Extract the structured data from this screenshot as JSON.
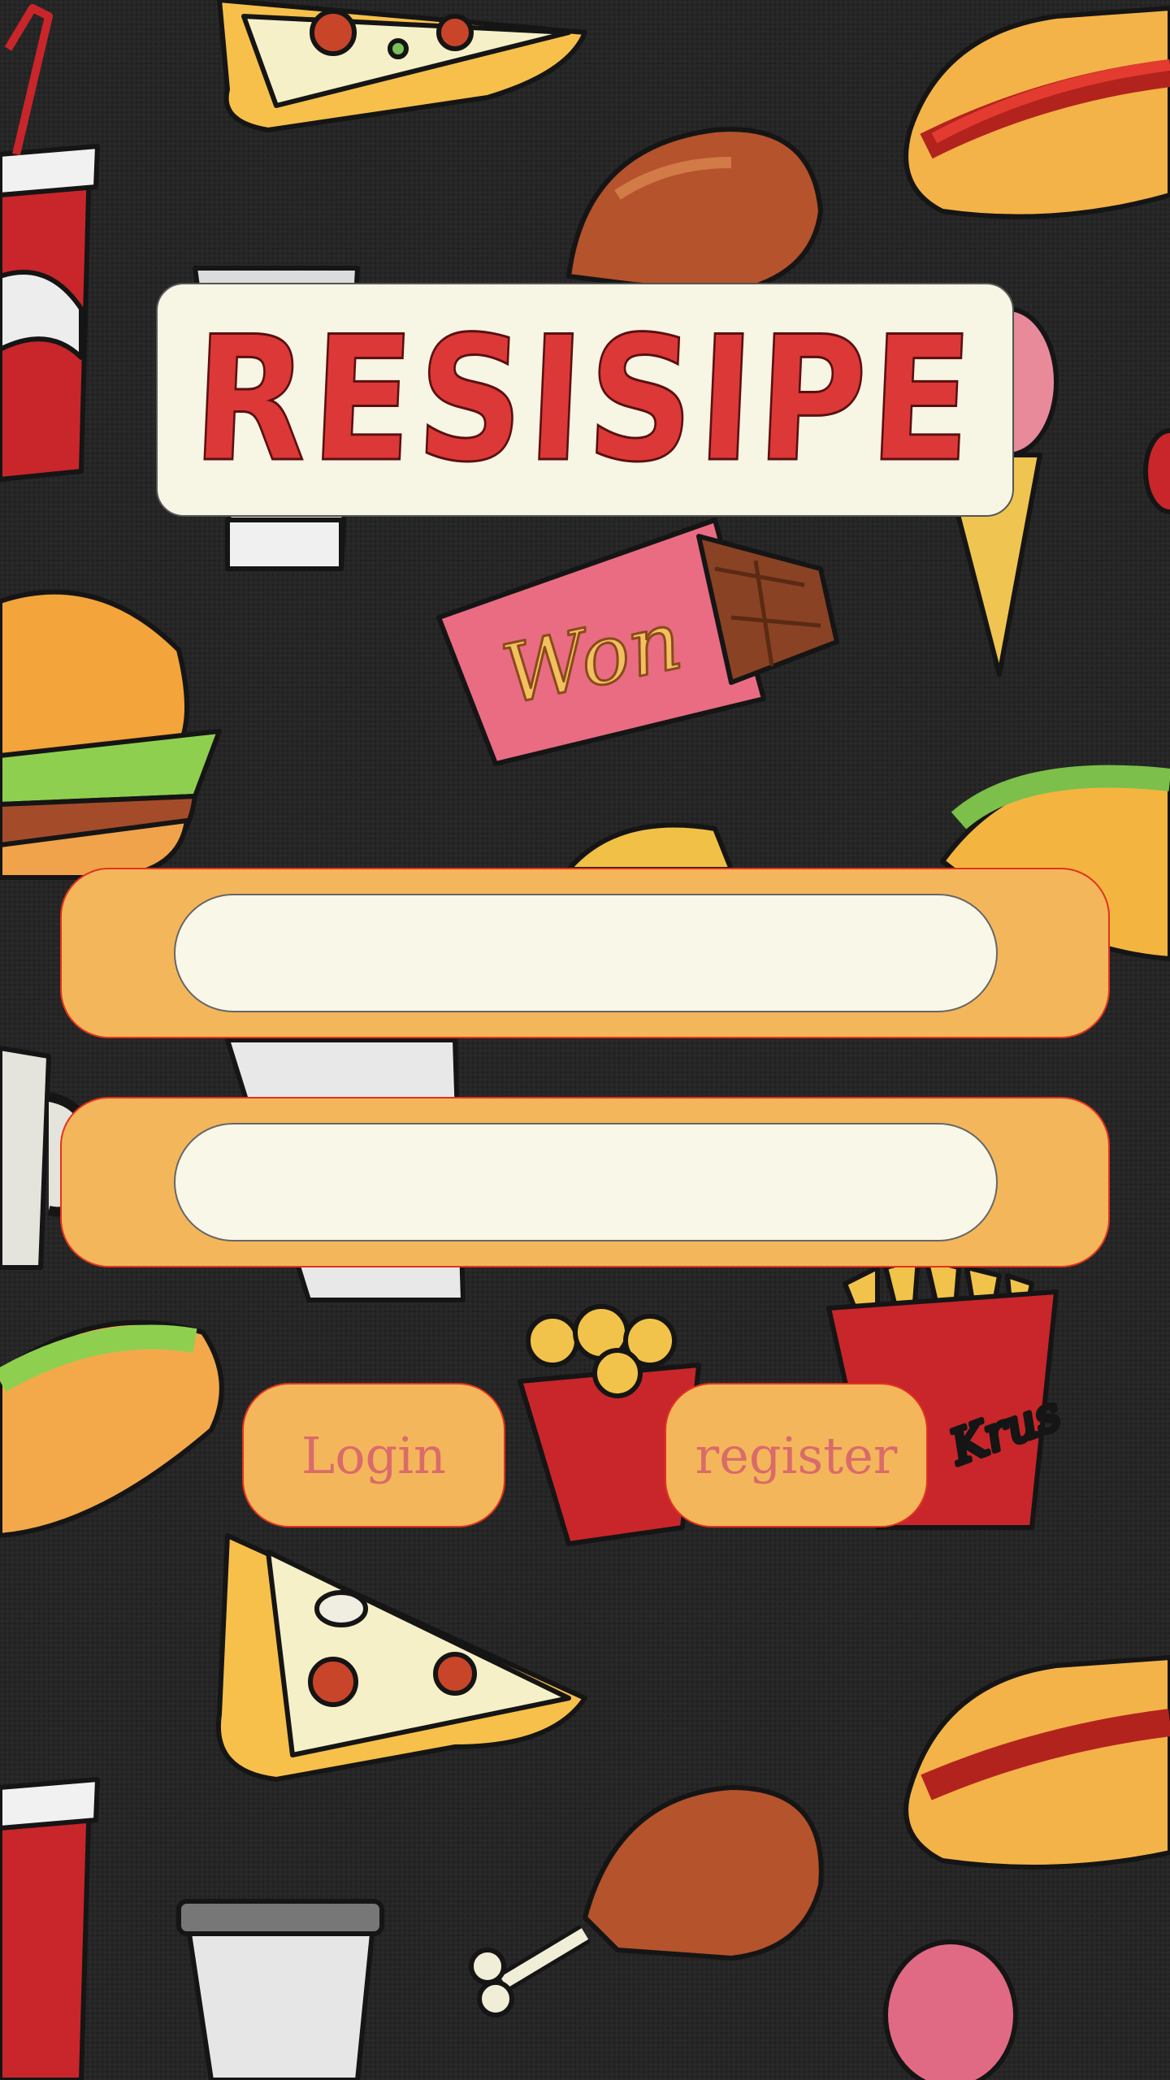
{
  "app": {
    "logo_text": "RESISIPE"
  },
  "form": {
    "username": {
      "value": "",
      "placeholder": ""
    },
    "password": {
      "value": "",
      "placeholder": ""
    }
  },
  "buttons": {
    "login_label": "Login",
    "register_label": "register"
  },
  "background": {
    "wrapper_text": "Won",
    "fries_box_text": "Krus"
  },
  "colors": {
    "background": "#262626",
    "logo_card": "#f7f5e4",
    "logo_text": "#dc3838",
    "accent_orange": "#f4b65a",
    "border_red": "#e0331e",
    "button_text": "#d96b6b",
    "input_fill": "#f8f7e8"
  }
}
